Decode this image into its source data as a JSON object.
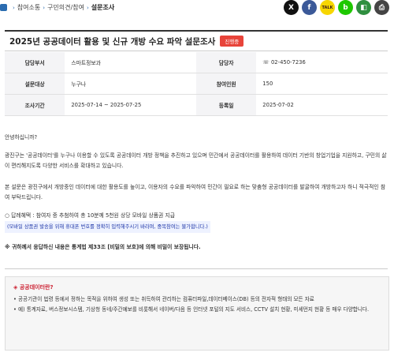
{
  "breadcrumb": {
    "items": [
      "참여소통",
      "구민의견/참여"
    ],
    "current": "설문조사"
  },
  "share": {
    "icons": [
      {
        "name": "x-icon",
        "label": "X",
        "color": "#111111"
      },
      {
        "name": "facebook-icon",
        "label": "f",
        "color": "#3b5998"
      },
      {
        "name": "kakaotalk-icon",
        "label": "TALK",
        "color": "#f7d600"
      },
      {
        "name": "band-icon",
        "label": "b",
        "color": "#1ec800"
      },
      {
        "name": "blog-icon",
        "label": "◧",
        "color": "#2f8f3f"
      },
      {
        "name": "print-icon",
        "label": "⎙",
        "color": "#444444"
      }
    ]
  },
  "survey": {
    "title": "2025년 공공데이터 활용 및 신규 개방 수요 파악 설문조사",
    "status": "진행중",
    "fields": {
      "dept_label": "담당부서",
      "dept": "스마트정보과",
      "manager_label": "담당자",
      "phone": "02-450-7236",
      "target_label": "설문대상",
      "target": "누구나",
      "participants_label": "참여인원",
      "participants": "150",
      "period_label": "조사기간",
      "period": "2025-07-14 ~ 2025-07-25",
      "regdate_label": "등록일",
      "regdate": "2025-07-02"
    }
  },
  "content": {
    "greeting": "안녕하십니까?",
    "para1": "광진구는 '공공데이터'를 누구나 이용할 수 있도록 공공데이터 개방 정책을 추진하고 있으며 민간에서 공공데이터를 활용하여 데이터 기반의 창업기업을 지원하고, 구민의 삶이 편리해지도록 다양한 서비스를 확대하고 있습니다.",
    "para2": "본 설문은 광진구에서 개방중인 데이터에 대한 활용도를 높이고, 이용자의 수요를 파악하여 민간이 필요로 하는 맞춤형 공공데이터를 발굴하여 개방하고자 하니 적극적인 참여 부탁드립니다.",
    "reward": "○ 답례혜택 : 참여자 중 추첨하여 총 10분께 5천원 상당 모바일 상품권 지급",
    "reward_note": "(모바일 상품권 발송을 위해 휴대폰 번호를 정확히 입력해주시기 바라며, 중복참여는 불가합니다.)",
    "privacy": "※ 귀하께서 응답하신 내용은 통계법 제33조 [비밀의 보호]에 의해 비밀이 보장됩니다."
  },
  "info_box": {
    "title": "◈ 공공데이터란?",
    "line1": "• 공공기관이 법령 등에서 정하는 목적을 위하여 생성 또는 취득하여 관리하는 컴퓨터파일,데이터베이스(DB) 등의 전자적 형태의 모든 자료",
    "line2": "• 예) 통계자료, 버스정보시스템, 기상청 동네/주간예보를 비롯해서 네이버/다음 등 인터넷 포털의 지도 서비스, CCTV 설치 현황, 미세먼지 현황 등 매우 다양합니다."
  }
}
